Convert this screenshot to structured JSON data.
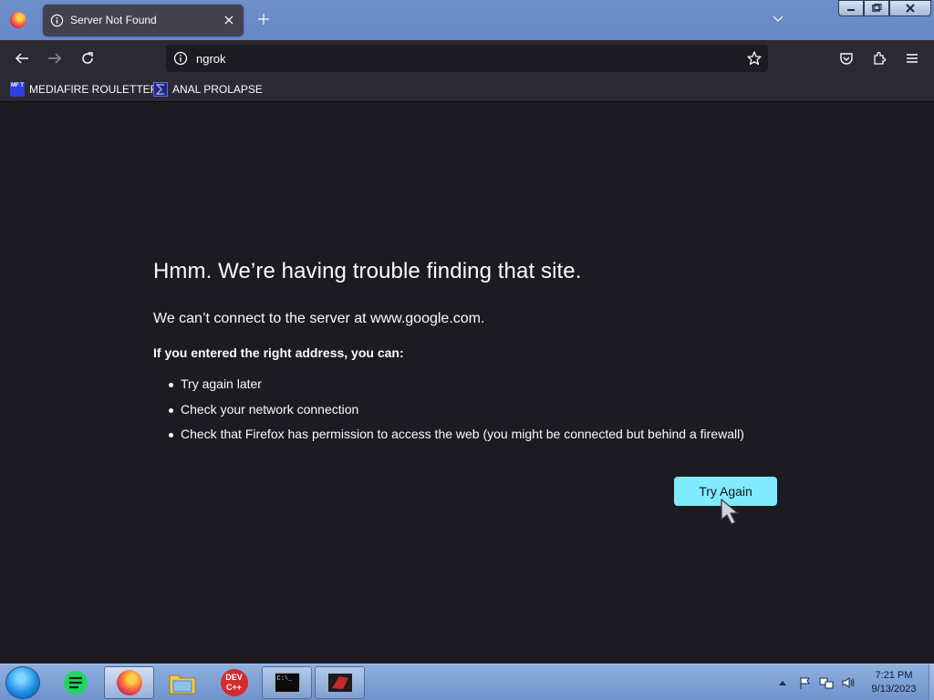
{
  "tab": {
    "title": "Server Not Found"
  },
  "urlbar": {
    "text": "ngrok"
  },
  "bookmarks": [
    {
      "label": "MEDIAFIRE ROULETTER",
      "icon": "mediafire-tool-icon",
      "icon_text": "MF T"
    },
    {
      "label": "ANAL PROLAPSE",
      "icon": "sigma-icon"
    }
  ],
  "error": {
    "title": "Hmm. We’re having trouble finding that site.",
    "description": "We can’t connect to the server at www.google.com.",
    "subheading": "If you entered the right address, you can:",
    "suggestions": [
      "Try again later",
      "Check your network connection",
      "Check that Firefox has permission to access the web (you might be connected but behind a firewall)"
    ],
    "button_label": "Try Again"
  },
  "taskbar": {
    "apps": [
      "firefox-icon",
      "notepad-icon",
      "firefox-icon",
      "file-explorer-icon",
      "devcpp-icon",
      "command-prompt-icon",
      "game-icon"
    ],
    "devcpp_text": "DEV C++",
    "cmd_text": "C:\\_",
    "time": "7:21 PM",
    "date": "9/13/2023"
  },
  "colors": {
    "content_bg": "#1c1b22",
    "toolbar_bg": "#2b2a33",
    "accent_button": "#80ebff",
    "tabbar_bg": "#6688c6"
  }
}
